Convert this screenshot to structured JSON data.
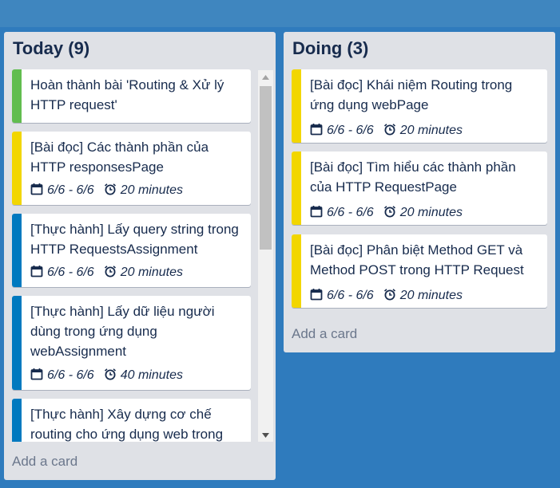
{
  "lists": [
    {
      "title": "Today (9)",
      "add_card_label": "Add a card",
      "cards": [
        {
          "color": "#61bd4f",
          "title": "Hoàn thành bài 'Routing & Xử lý HTTP request'"
        },
        {
          "color": "#f2d600",
          "title": "[Bài đọc] Các thành phần của HTTP responsesPage",
          "dates": "6/6 - 6/6",
          "duration": "20 minutes"
        },
        {
          "color": "#0079bf",
          "title": "[Thực hành] Lấy query string trong HTTP RequestsAssignment",
          "dates": "6/6 - 6/6",
          "duration": "20 minutes"
        },
        {
          "color": "#0079bf",
          "title": "[Thực hành] Lấy dữ liệu người dùng trong ứng dụng webAssignment",
          "dates": "6/6 - 6/6",
          "duration": "40 minutes"
        },
        {
          "color": "#0079bf",
          "title": "[Thực hành] Xây dựng cơ chế routing cho ứng dụng web trong"
        }
      ]
    },
    {
      "title": "Doing (3)",
      "add_card_label": "Add a card",
      "cards": [
        {
          "color": "#f2d600",
          "title": "[Bài đọc] Khái niệm Routing trong ứng dụng webPage",
          "dates": "6/6 - 6/6",
          "duration": "20 minutes"
        },
        {
          "color": "#f2d600",
          "title": "[Bài đọc] Tìm hiểu các thành phần của HTTP RequestPage",
          "dates": "6/6 - 6/6",
          "duration": "20 minutes"
        },
        {
          "color": "#f2d600",
          "title": "[Bài đọc] Phân biệt Method GET và Method POST trong HTTP Request",
          "dates": "6/6 - 6/6",
          "duration": "20 minutes"
        }
      ]
    }
  ],
  "icons": {
    "calendar": "calendar-icon",
    "clock": "alarm-clock-icon",
    "scroll_up": "scroll-up-arrow-icon",
    "scroll_down": "scroll-down-arrow-icon"
  }
}
